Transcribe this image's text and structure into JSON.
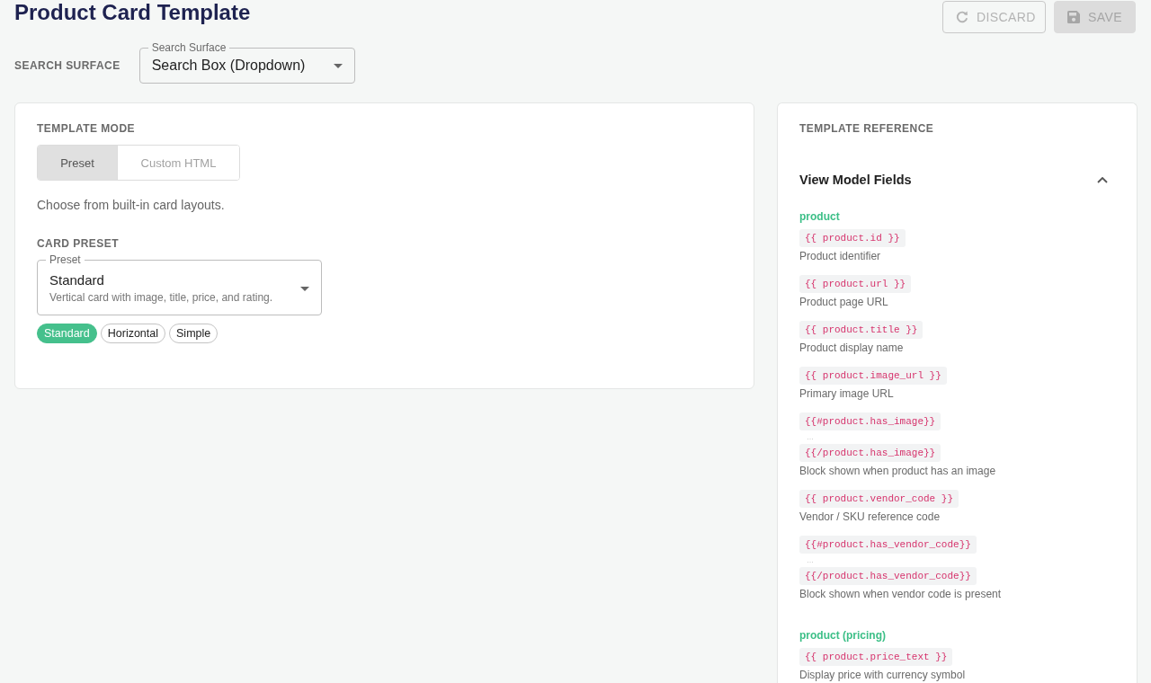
{
  "page": {
    "title": "Product Card Template"
  },
  "toolbar": {
    "buttons": [
      {
        "kind": "discard",
        "label": "DISCARD",
        "disabled": true
      },
      {
        "kind": "save",
        "label": "SAVE",
        "disabled": true
      }
    ]
  },
  "search_surface": {
    "label": "SEARCH SURFACE",
    "select": {
      "floating_label": "Search Surface",
      "value": "Search Box (Dropdown)"
    }
  },
  "template_mode": {
    "heading": "TEMPLATE MODE",
    "modes": [
      {
        "label": "Preset",
        "selected": true
      },
      {
        "label": "Custom HTML",
        "selected": false
      }
    ],
    "helper": "Choose from built-in card layouts.",
    "card_preset": {
      "heading": "CARD PRESET",
      "select": {
        "floating_label": "Preset",
        "value": "Standard",
        "description": "Vertical card with image, title, price, and rating."
      },
      "chips": [
        {
          "label": "Standard",
          "selected": true
        },
        {
          "label": "Horizontal",
          "selected": false
        },
        {
          "label": "Simple",
          "selected": false
        }
      ]
    }
  },
  "template_reference": {
    "heading": "TEMPLATE REFERENCE",
    "section": {
      "title": "View Model Fields",
      "expanded": true,
      "groups": [
        {
          "name": "product",
          "fields": [
            {
              "kind": "variable",
              "code": "{{ product.id }}",
              "description": "Product identifier"
            },
            {
              "kind": "variable",
              "code": "{{ product.url }}",
              "description": "Product page URL"
            },
            {
              "kind": "variable",
              "code": "{{ product.title }}",
              "description": "Product display name"
            },
            {
              "kind": "variable",
              "code": "{{ product.image_url }}",
              "description": "Primary image URL"
            },
            {
              "kind": "block",
              "open": "{{#product.has_image}}",
              "ellipsis": "…",
              "close": "{{/product.has_image}}",
              "description": "Block shown when product has an image"
            },
            {
              "kind": "variable",
              "code": "{{ product.vendor_code }}",
              "description": "Vendor / SKU reference code"
            },
            {
              "kind": "block",
              "open": "{{#product.has_vendor_code}}",
              "ellipsis": "…",
              "close": "{{/product.has_vendor_code}}",
              "description": "Block shown when vendor code is present"
            }
          ]
        },
        {
          "name": "product (pricing)",
          "fields": [
            {
              "kind": "variable",
              "code": "{{ product.price_text }}",
              "description": "Display price with currency symbol"
            }
          ]
        }
      ]
    }
  }
}
